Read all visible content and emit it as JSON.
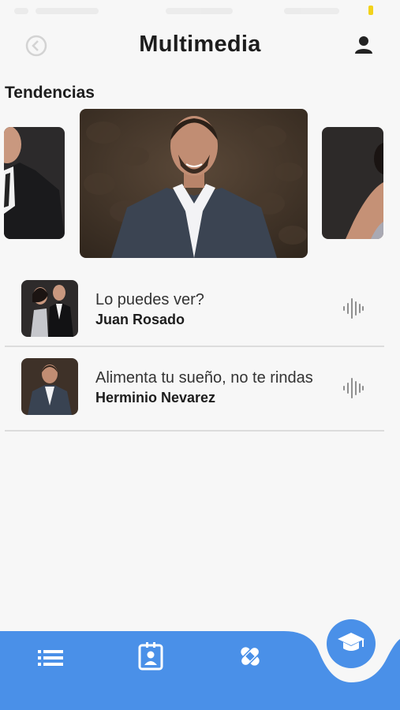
{
  "header": {
    "title": "Multimedia",
    "back_icon": "back-circle-icon",
    "profile_icon": "user-icon"
  },
  "trending": {
    "title": "Tendencias",
    "cards": [
      {
        "name": "portrait-left"
      },
      {
        "name": "portrait-center"
      },
      {
        "name": "portrait-right"
      }
    ]
  },
  "tracks": [
    {
      "song": "Lo puedes ver?",
      "artist": "Juan Rosado",
      "icon": "audio-wave-icon"
    },
    {
      "song": "Alimenta tu sueño, no te rindas",
      "artist": "Herminio Nevarez",
      "icon": "audio-wave-icon"
    }
  ],
  "nav": {
    "items": [
      "list-icon",
      "contact-card-icon",
      "bandage-icon"
    ],
    "fab_icon": "graduation-cap-icon"
  },
  "colors": {
    "accent": "#4a90e8",
    "background": "#f7f7f7",
    "divider": "#dcdcdc"
  }
}
